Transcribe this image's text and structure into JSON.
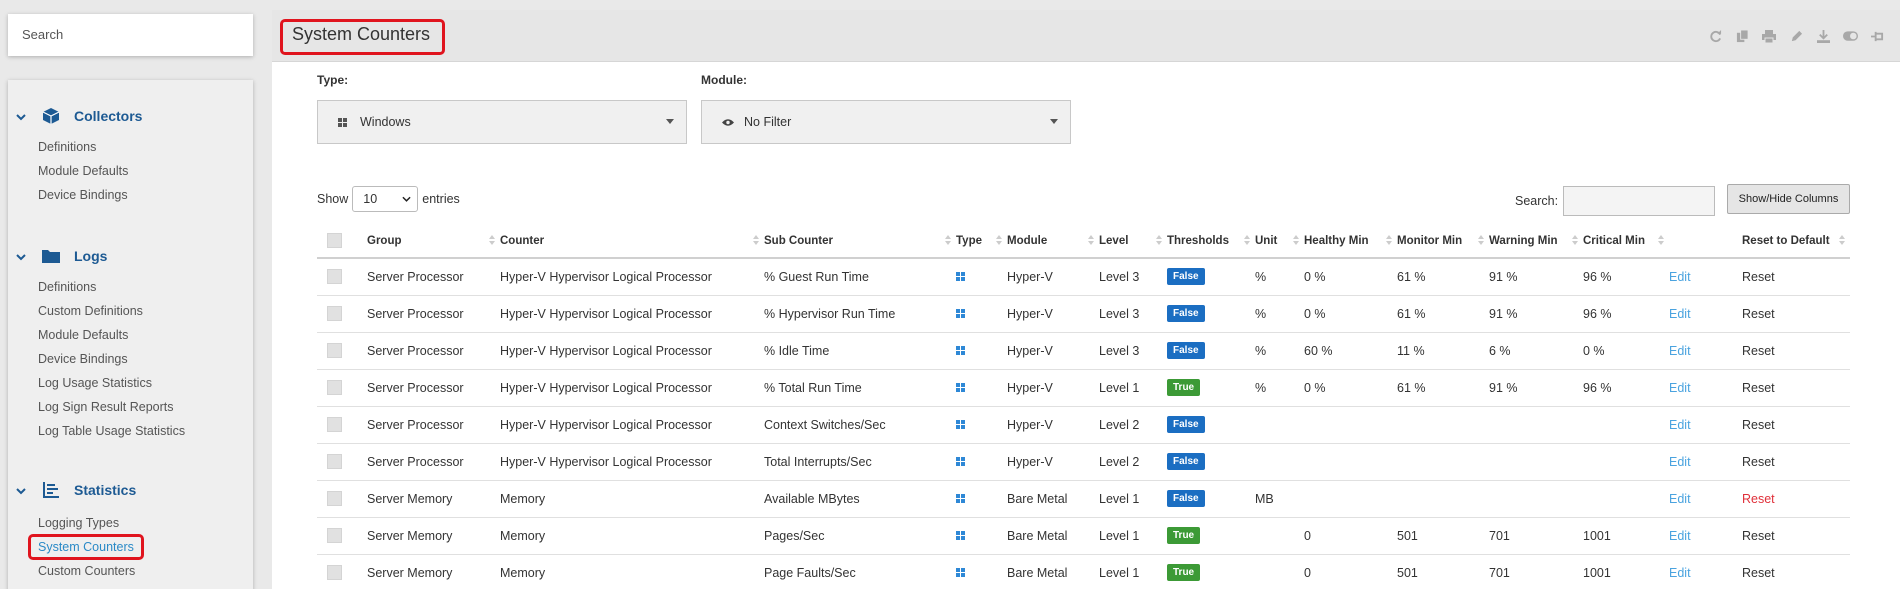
{
  "sidebar": {
    "search_placeholder": "Search",
    "sections": [
      {
        "title": "Collectors",
        "icon": "cube-icon",
        "items": [
          "Definitions",
          "Module Defaults",
          "Device Bindings"
        ]
      },
      {
        "title": "Logs",
        "icon": "folder-icon",
        "items": [
          "Definitions",
          "Custom Definitions",
          "Module Defaults",
          "Device Bindings",
          "Log Usage Statistics",
          "Log Sign Result Reports",
          "Log Table Usage Statistics"
        ]
      },
      {
        "title": "Statistics",
        "icon": "bar-chart-icon",
        "items": [
          "Logging Types",
          "System Counters",
          "Custom Counters"
        ]
      }
    ],
    "active_item": "System Counters"
  },
  "header": {
    "title": "System Counters",
    "toolbar_icons": [
      "refresh-icon",
      "copy-icon",
      "print-icon",
      "edit-icon",
      "download-icon",
      "toggle-icon",
      "pin-icon"
    ]
  },
  "filters": {
    "type_label": "Type:",
    "type_value": "Windows",
    "module_label": "Module:",
    "module_value": "No Filter"
  },
  "table_controls": {
    "show_label": "Show",
    "entries_value": "10",
    "entries_label": "entries",
    "search_label": "Search:",
    "columns_button": "Show/Hide Columns"
  },
  "columns": [
    "Group",
    "Counter",
    "Sub Counter",
    "Type",
    "Module",
    "Level",
    "Thresholds",
    "Unit",
    "Healthy Min",
    "Monitor Min",
    "Warning Min",
    "Critical Min",
    "",
    "Reset to Default"
  ],
  "rows": [
    {
      "group": "Server Processor",
      "counter": "Hyper-V Hypervisor Logical Processor",
      "sub": "% Guest Run Time",
      "module": "Hyper-V",
      "level": "Level 3",
      "thresholds": "False",
      "unit": "%",
      "healthy": "0 %",
      "monitor": "61 %",
      "warning": "91 %",
      "critical": "96 %",
      "edit": "Edit",
      "reset": "Reset"
    },
    {
      "group": "Server Processor",
      "counter": "Hyper-V Hypervisor Logical Processor",
      "sub": "% Hypervisor Run Time",
      "module": "Hyper-V",
      "level": "Level 3",
      "thresholds": "False",
      "unit": "%",
      "healthy": "0 %",
      "monitor": "61 %",
      "warning": "91 %",
      "critical": "96 %",
      "edit": "Edit",
      "reset": "Reset"
    },
    {
      "group": "Server Processor",
      "counter": "Hyper-V Hypervisor Logical Processor",
      "sub": "% Idle Time",
      "module": "Hyper-V",
      "level": "Level 3",
      "thresholds": "False",
      "unit": "%",
      "healthy": "60 %",
      "monitor": "11 %",
      "warning": "6 %",
      "critical": "0 %",
      "edit": "Edit",
      "reset": "Reset"
    },
    {
      "group": "Server Processor",
      "counter": "Hyper-V Hypervisor Logical Processor",
      "sub": "% Total Run Time",
      "module": "Hyper-V",
      "level": "Level 1",
      "thresholds": "True",
      "unit": "%",
      "healthy": "0 %",
      "monitor": "61 %",
      "warning": "91 %",
      "critical": "96 %",
      "edit": "Edit",
      "reset": "Reset"
    },
    {
      "group": "Server Processor",
      "counter": "Hyper-V Hypervisor Logical Processor",
      "sub": "Context Switches/Sec",
      "module": "Hyper-V",
      "level": "Level 2",
      "thresholds": "False",
      "unit": "",
      "healthy": "",
      "monitor": "",
      "warning": "",
      "critical": "",
      "edit": "Edit",
      "reset": "Reset"
    },
    {
      "group": "Server Processor",
      "counter": "Hyper-V Hypervisor Logical Processor",
      "sub": "Total Interrupts/Sec",
      "module": "Hyper-V",
      "level": "Level 2",
      "thresholds": "False",
      "unit": "",
      "healthy": "",
      "monitor": "",
      "warning": "",
      "critical": "",
      "edit": "Edit",
      "reset": "Reset"
    },
    {
      "group": "Server Memory",
      "counter": "Memory",
      "sub": "Available MBytes",
      "module": "Bare Metal",
      "level": "Level 1",
      "thresholds": "False",
      "unit": "MB",
      "healthy": "",
      "monitor": "",
      "warning": "",
      "critical": "",
      "edit": "Edit",
      "reset": "Reset",
      "reset_red": true
    },
    {
      "group": "Server Memory",
      "counter": "Memory",
      "sub": "Pages/Sec",
      "module": "Bare Metal",
      "level": "Level 1",
      "thresholds": "True",
      "unit": "",
      "healthy": "0",
      "monitor": "501",
      "warning": "701",
      "critical": "1001",
      "edit": "Edit",
      "reset": "Reset"
    },
    {
      "group": "Server Memory",
      "counter": "Memory",
      "sub": "Page Faults/Sec",
      "module": "Bare Metal",
      "level": "Level 1",
      "thresholds": "True",
      "unit": "",
      "healthy": "0",
      "monitor": "501",
      "warning": "701",
      "critical": "1001",
      "edit": "Edit",
      "reset": "Reset"
    }
  ],
  "colors": {
    "accent": "#1d5a93",
    "link": "#4aa3df",
    "false_badge": "#1b6ec2",
    "true_badge": "#3c9a36",
    "highlight": "#e0141e",
    "reset_red": "#e0303a"
  }
}
